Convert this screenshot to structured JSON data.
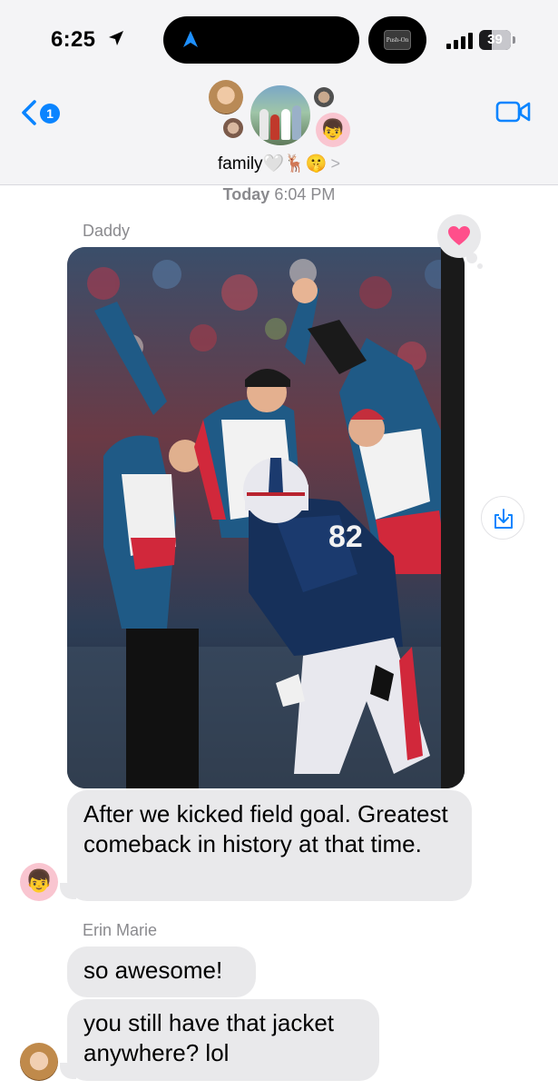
{
  "status_bar": {
    "time": "6:25",
    "battery": "39",
    "battery_level": 0.39,
    "location_icon": "location-arrow-icon",
    "signal_icon": "cellular-signal-icon"
  },
  "header": {
    "back_badge": "1",
    "group_name": "family🤍🦌🤫",
    "chevron": ">",
    "now_playing_thumb": "Push-On",
    "video_icon": "video-camera-icon",
    "emoji_avatar": "👦"
  },
  "conversation": {
    "timestamp_day": "Today",
    "timestamp_time": "6:04 PM",
    "messages": [
      {
        "sender": "Daddy",
        "type": "photo",
        "tapback": "heart",
        "photo_icon": "football-celebration-photo"
      },
      {
        "sender": "Daddy",
        "type": "text",
        "text": "After we kicked field goal. Greatest comeback in history at that time.",
        "avatar": "👦"
      },
      {
        "sender": "Erin Marie",
        "type": "text",
        "text": "so awesome!"
      },
      {
        "sender": "Erin Marie",
        "type": "text",
        "text": "you still have that jacket anywhere? lol"
      }
    ]
  },
  "colors": {
    "accent": "#0a84ff",
    "bubble_incoming": "#e9e9eb",
    "header_bg": "#f4f4f6",
    "heart": "#ff4f8b"
  }
}
